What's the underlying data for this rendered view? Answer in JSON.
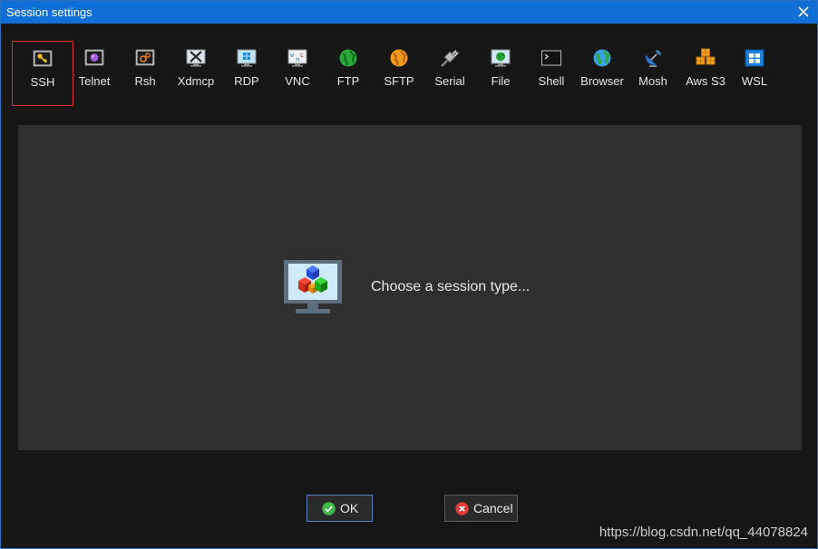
{
  "window": {
    "title": "Session settings"
  },
  "session_types": [
    {
      "label": "SSH",
      "icon": "key-icon",
      "selected": true
    },
    {
      "label": "Telnet",
      "icon": "telnet-icon"
    },
    {
      "label": "Rsh",
      "icon": "rsh-icon"
    },
    {
      "label": "Xdmcp",
      "icon": "xdmcp-icon"
    },
    {
      "label": "RDP",
      "icon": "rdp-icon"
    },
    {
      "label": "VNC",
      "icon": "vnc-icon"
    },
    {
      "label": "FTP",
      "icon": "ftp-globe-icon"
    },
    {
      "label": "SFTP",
      "icon": "sftp-globe-icon"
    },
    {
      "label": "Serial",
      "icon": "serial-plug-icon"
    },
    {
      "label": "File",
      "icon": "file-monitor-icon"
    },
    {
      "label": "Shell",
      "icon": "shell-terminal-icon"
    },
    {
      "label": "Browser",
      "icon": "browser-globe-icon"
    },
    {
      "label": "Mosh",
      "icon": "mosh-dish-icon"
    },
    {
      "label": "Aws S3",
      "icon": "aws-cubes-icon"
    },
    {
      "label": "WSL",
      "icon": "windows-icon"
    }
  ],
  "panel": {
    "prompt": "Choose a session type..."
  },
  "buttons": {
    "ok": "OK",
    "cancel": "Cancel"
  },
  "watermark": "https://blog.csdn.net/qq_44078824",
  "colors": {
    "titlebar": "#0f6fd6",
    "selected_border": "#d9302a",
    "panel": "#2f2f2f",
    "background": "#161616"
  }
}
